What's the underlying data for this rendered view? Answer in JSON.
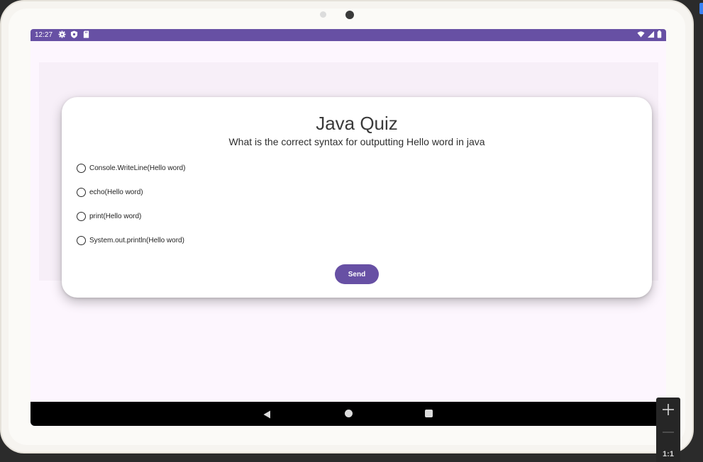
{
  "status_bar": {
    "time": "12:27",
    "left_icons": [
      "settings-gear-icon",
      "shield-icon",
      "sd-card-icon"
    ],
    "right_icons": [
      "wifi-icon",
      "signal-icon",
      "battery-icon"
    ],
    "color": "#6750a4"
  },
  "quiz": {
    "title": "Java Quiz",
    "question": "What is the correct syntax for outputting Hello word in java",
    "options": [
      {
        "label": "Console.WriteLine(Hello word)",
        "selected": false
      },
      {
        "label": "echo(Hello word)",
        "selected": false
      },
      {
        "label": "print(Hello word)",
        "selected": false
      },
      {
        "label": "System.out.println(Hello word)",
        "selected": false
      }
    ],
    "send_label": "Send"
  },
  "nav_bar": {
    "buttons": [
      "back-icon",
      "home-icon",
      "recents-icon"
    ]
  },
  "emulator_zoom": {
    "zoom_in_icon": "plus-icon",
    "zoom_out_icon": "minus-icon",
    "reset_label": "1:1"
  },
  "colors": {
    "accent": "#6750a4",
    "screen_background": "#fdf6fe",
    "card_background": "#ffffff"
  }
}
